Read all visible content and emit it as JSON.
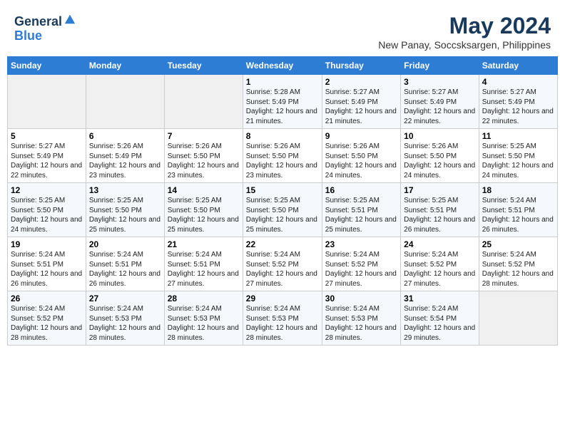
{
  "header": {
    "logo_line1": "General",
    "logo_line2": "Blue",
    "title": "May 2024",
    "subtitle": "New Panay, Soccsksargen, Philippines"
  },
  "days_of_week": [
    "Sunday",
    "Monday",
    "Tuesday",
    "Wednesday",
    "Thursday",
    "Friday",
    "Saturday"
  ],
  "weeks": [
    [
      {
        "day": "",
        "info": ""
      },
      {
        "day": "",
        "info": ""
      },
      {
        "day": "",
        "info": ""
      },
      {
        "day": "1",
        "info": "Sunrise: 5:28 AM\nSunset: 5:49 PM\nDaylight: 12 hours and 21 minutes."
      },
      {
        "day": "2",
        "info": "Sunrise: 5:27 AM\nSunset: 5:49 PM\nDaylight: 12 hours and 21 minutes."
      },
      {
        "day": "3",
        "info": "Sunrise: 5:27 AM\nSunset: 5:49 PM\nDaylight: 12 hours and 22 minutes."
      },
      {
        "day": "4",
        "info": "Sunrise: 5:27 AM\nSunset: 5:49 PM\nDaylight: 12 hours and 22 minutes."
      }
    ],
    [
      {
        "day": "5",
        "info": "Sunrise: 5:27 AM\nSunset: 5:49 PM\nDaylight: 12 hours and 22 minutes."
      },
      {
        "day": "6",
        "info": "Sunrise: 5:26 AM\nSunset: 5:49 PM\nDaylight: 12 hours and 23 minutes."
      },
      {
        "day": "7",
        "info": "Sunrise: 5:26 AM\nSunset: 5:50 PM\nDaylight: 12 hours and 23 minutes."
      },
      {
        "day": "8",
        "info": "Sunrise: 5:26 AM\nSunset: 5:50 PM\nDaylight: 12 hours and 23 minutes."
      },
      {
        "day": "9",
        "info": "Sunrise: 5:26 AM\nSunset: 5:50 PM\nDaylight: 12 hours and 24 minutes."
      },
      {
        "day": "10",
        "info": "Sunrise: 5:26 AM\nSunset: 5:50 PM\nDaylight: 12 hours and 24 minutes."
      },
      {
        "day": "11",
        "info": "Sunrise: 5:25 AM\nSunset: 5:50 PM\nDaylight: 12 hours and 24 minutes."
      }
    ],
    [
      {
        "day": "12",
        "info": "Sunrise: 5:25 AM\nSunset: 5:50 PM\nDaylight: 12 hours and 24 minutes."
      },
      {
        "day": "13",
        "info": "Sunrise: 5:25 AM\nSunset: 5:50 PM\nDaylight: 12 hours and 25 minutes."
      },
      {
        "day": "14",
        "info": "Sunrise: 5:25 AM\nSunset: 5:50 PM\nDaylight: 12 hours and 25 minutes."
      },
      {
        "day": "15",
        "info": "Sunrise: 5:25 AM\nSunset: 5:50 PM\nDaylight: 12 hours and 25 minutes."
      },
      {
        "day": "16",
        "info": "Sunrise: 5:25 AM\nSunset: 5:51 PM\nDaylight: 12 hours and 25 minutes."
      },
      {
        "day": "17",
        "info": "Sunrise: 5:25 AM\nSunset: 5:51 PM\nDaylight: 12 hours and 26 minutes."
      },
      {
        "day": "18",
        "info": "Sunrise: 5:24 AM\nSunset: 5:51 PM\nDaylight: 12 hours and 26 minutes."
      }
    ],
    [
      {
        "day": "19",
        "info": "Sunrise: 5:24 AM\nSunset: 5:51 PM\nDaylight: 12 hours and 26 minutes."
      },
      {
        "day": "20",
        "info": "Sunrise: 5:24 AM\nSunset: 5:51 PM\nDaylight: 12 hours and 26 minutes."
      },
      {
        "day": "21",
        "info": "Sunrise: 5:24 AM\nSunset: 5:51 PM\nDaylight: 12 hours and 27 minutes."
      },
      {
        "day": "22",
        "info": "Sunrise: 5:24 AM\nSunset: 5:52 PM\nDaylight: 12 hours and 27 minutes."
      },
      {
        "day": "23",
        "info": "Sunrise: 5:24 AM\nSunset: 5:52 PM\nDaylight: 12 hours and 27 minutes."
      },
      {
        "day": "24",
        "info": "Sunrise: 5:24 AM\nSunset: 5:52 PM\nDaylight: 12 hours and 27 minutes."
      },
      {
        "day": "25",
        "info": "Sunrise: 5:24 AM\nSunset: 5:52 PM\nDaylight: 12 hours and 28 minutes."
      }
    ],
    [
      {
        "day": "26",
        "info": "Sunrise: 5:24 AM\nSunset: 5:52 PM\nDaylight: 12 hours and 28 minutes."
      },
      {
        "day": "27",
        "info": "Sunrise: 5:24 AM\nSunset: 5:53 PM\nDaylight: 12 hours and 28 minutes."
      },
      {
        "day": "28",
        "info": "Sunrise: 5:24 AM\nSunset: 5:53 PM\nDaylight: 12 hours and 28 minutes."
      },
      {
        "day": "29",
        "info": "Sunrise: 5:24 AM\nSunset: 5:53 PM\nDaylight: 12 hours and 28 minutes."
      },
      {
        "day": "30",
        "info": "Sunrise: 5:24 AM\nSunset: 5:53 PM\nDaylight: 12 hours and 28 minutes."
      },
      {
        "day": "31",
        "info": "Sunrise: 5:24 AM\nSunset: 5:54 PM\nDaylight: 12 hours and 29 minutes."
      },
      {
        "day": "",
        "info": ""
      }
    ]
  ]
}
